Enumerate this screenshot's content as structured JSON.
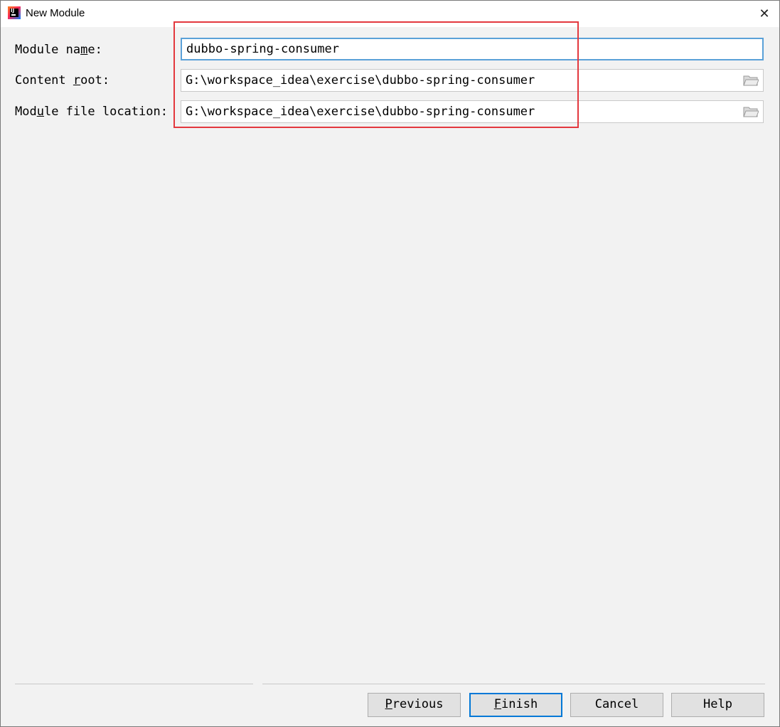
{
  "window": {
    "title": "New Module"
  },
  "icons": {
    "app": "intellij-app-icon",
    "close": "close-icon",
    "folder": "folder-icon"
  },
  "form": {
    "module_name": {
      "label_pre": "Module na",
      "label_key": "m",
      "label_post": "e:",
      "value": "dubbo-spring-consumer"
    },
    "content_root": {
      "label_pre": "Content ",
      "label_key": "r",
      "label_post": "oot:",
      "value": "G:\\workspace_idea\\exercise\\dubbo-spring-consumer"
    },
    "module_file_location": {
      "label_pre": "Mod",
      "label_key": "u",
      "label_post": "le file location:",
      "value": "G:\\workspace_idea\\exercise\\dubbo-spring-consumer"
    }
  },
  "buttons": {
    "previous": {
      "key": "P",
      "rest": "revious"
    },
    "finish": {
      "key": "F",
      "rest": "inish"
    },
    "cancel": {
      "label": "Cancel"
    },
    "help": {
      "label": "Help"
    }
  },
  "colors": {
    "highlight": "#e3383e",
    "focus_border": "#5aa1d8",
    "default_button_border": "#0078d7"
  }
}
